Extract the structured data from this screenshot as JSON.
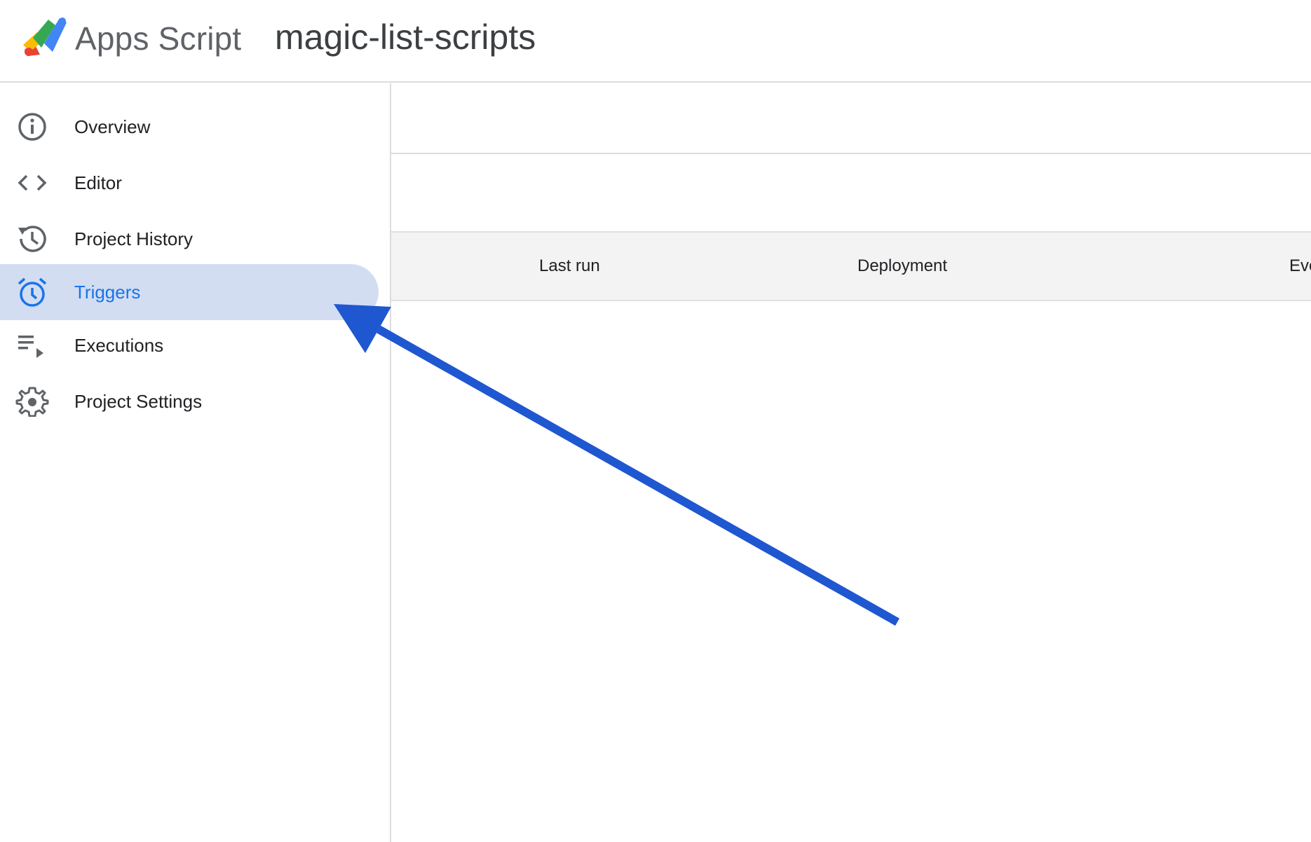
{
  "header": {
    "product_name": "Apps Script",
    "project_name": "magic-list-scripts"
  },
  "sidebar": {
    "items": [
      {
        "label": "Overview",
        "icon": "info-icon",
        "active": false
      },
      {
        "label": "Editor",
        "icon": "code-icon",
        "active": false
      },
      {
        "label": "Project History",
        "icon": "history-icon",
        "active": false
      },
      {
        "label": "Triggers",
        "icon": "alarm-clock-icon",
        "active": true
      },
      {
        "label": "Executions",
        "icon": "playlist-play-icon",
        "active": false
      },
      {
        "label": "Project Settings",
        "icon": "gear-icon",
        "active": false
      }
    ]
  },
  "table": {
    "columns": [
      "Last run",
      "Deployment",
      "Eve"
    ]
  },
  "colors": {
    "active_bg": "#d2ddf2",
    "active_text": "#1a73e8",
    "annotation_arrow": "#1f57d1",
    "icon_gray": "#5f6368"
  }
}
